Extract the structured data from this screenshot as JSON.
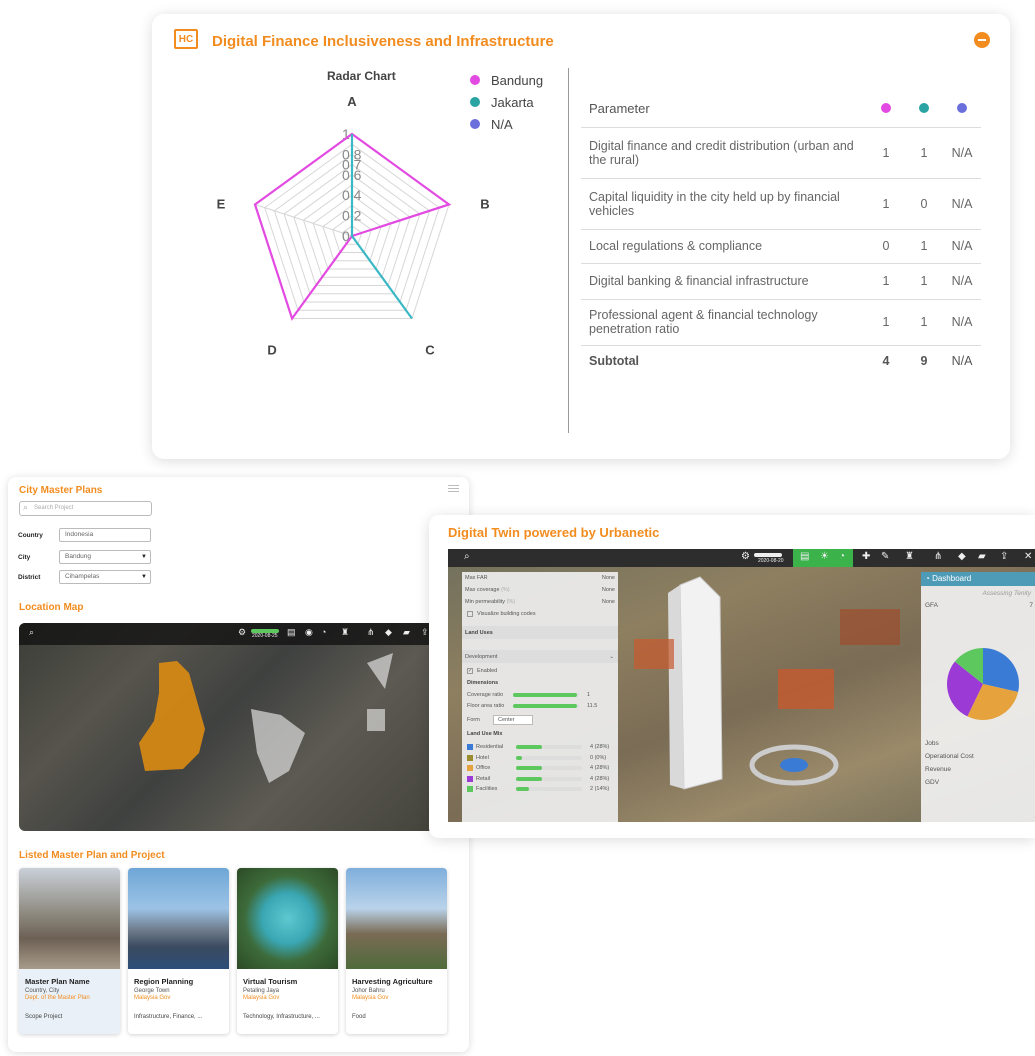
{
  "finance": {
    "title": "Digital Finance Inclusiveness and Infrastructure",
    "logo": "HC",
    "radar": {
      "title": "Radar Chart",
      "axes": [
        "A",
        "B",
        "C",
        "D",
        "E"
      ],
      "ticks": [
        "1",
        "0.8",
        "0.7",
        "0.6",
        "0.4",
        "0.2",
        "0"
      ]
    },
    "legend": [
      {
        "name": "Bandung",
        "color": "#e24ae2"
      },
      {
        "name": "Jakarta",
        "color": "#2aa3a3"
      },
      {
        "name": "N/A",
        "color": "#6b6fdc"
      }
    ],
    "table": {
      "header": "Parameter",
      "dots": [
        "#e24ae2",
        "#2aa3a3",
        "#6b6fdc"
      ],
      "rows": [
        {
          "p": "Digital finance and credit distribution (urban and the rural)",
          "a": "1",
          "b": "1",
          "c": "N/A"
        },
        {
          "p": "Capital liquidity in the city held up by financial vehicles",
          "a": "1",
          "b": "0",
          "c": "N/A"
        },
        {
          "p": "Local regulations & compliance",
          "a": "0",
          "b": "1",
          "c": "N/A"
        },
        {
          "p": "Digital banking & financial infrastructure",
          "a": "1",
          "b": "1",
          "c": "N/A"
        },
        {
          "p": "Professional agent & financial technology penetration ratio",
          "a": "1",
          "b": "1",
          "c": "N/A"
        }
      ],
      "subtotal": {
        "p": "Subtotal",
        "a": "4",
        "b": "9",
        "c": "N/A"
      }
    }
  },
  "chart_data": {
    "type": "radar",
    "title": "Radar Chart",
    "categories": [
      "A",
      "B",
      "C",
      "D",
      "E"
    ],
    "rlim": [
      0,
      1
    ],
    "series": [
      {
        "name": "Bandung",
        "values": [
          1,
          1,
          0,
          1,
          1
        ]
      },
      {
        "name": "Jakarta",
        "values": [
          1,
          0,
          1,
          0,
          0
        ]
      }
    ],
    "legend": "top-right"
  },
  "cmp": {
    "title": "City Master Plans",
    "search_placeholder": "Search Project",
    "country_label": "Country",
    "country_value": "Indonesia",
    "city_label": "City",
    "city_value": "Bandung",
    "district_label": "District",
    "district_value": "Cihampelas",
    "location_title": "Location Map",
    "map_date": "2020-08-25",
    "listed_title": "Listed Master Plan and Project",
    "cards": [
      {
        "name": "Master Plan Name",
        "loc": "Country, City",
        "org": "Dept. of the Master Plan",
        "tags": "Scope Project"
      },
      {
        "name": "Region Planning",
        "loc": "George Town",
        "org": "Malaysia Gov",
        "tags": "Infrastructure, Finance, ..."
      },
      {
        "name": "Virtual Tourism",
        "loc": "Petaling Jaya",
        "org": "Malaysia Gov",
        "tags": "Technology, Infrastructure, ..."
      },
      {
        "name": "Harvesting Agriculture",
        "loc": "Johor Bahru",
        "org": "Malaysia Gov",
        "tags": "Food"
      }
    ]
  },
  "twin": {
    "title": "Digital Twin powered by Urbanetic",
    "date": "2020-08-20",
    "panel": {
      "max_far": "Max FAR",
      "max_far_v": "None",
      "max_cov": "Max coverage",
      "max_cov_u": "(%)",
      "max_cov_v": "None",
      "min_perm": "Min permeability",
      "min_perm_u": "(%)",
      "min_perm_v": "None",
      "visualize": "Visualize building codes",
      "land_uses": "Land Uses",
      "development": "Development",
      "enabled": "Enabled",
      "dimensions": "Dimensions",
      "coverage": "Coverage ratio",
      "coverage_v": "1",
      "floor": "Floor area ratio",
      "floor_v": "11.5",
      "form": "Form",
      "form_v": "Center",
      "mix": "Land Use Mix",
      "mix_items": [
        {
          "name": "Residential",
          "v": "4 (28%)",
          "color": "#3a7bd5",
          "frac": 0.28
        },
        {
          "name": "Hotel",
          "v": "0 (0%)",
          "color": "#9a8d2e",
          "frac": 0
        },
        {
          "name": "Office",
          "v": "4 (28%)",
          "color": "#e6a23c",
          "frac": 0.28
        },
        {
          "name": "Retail",
          "v": "4 (28%)",
          "color": "#9b3ad5",
          "frac": 0.28
        },
        {
          "name": "Facilities",
          "v": "2 (14%)",
          "color": "#5dc85d",
          "frac": 0.14
        }
      ]
    },
    "dashboard": {
      "title": "Dashboard",
      "sub": "Assessing Tenity",
      "gfa": "GFA",
      "gfa_v": "7",
      "jobs": "Jobs",
      "opcost": "Operational Cost",
      "revenue": "Revenue",
      "gdv": "GDV"
    }
  }
}
